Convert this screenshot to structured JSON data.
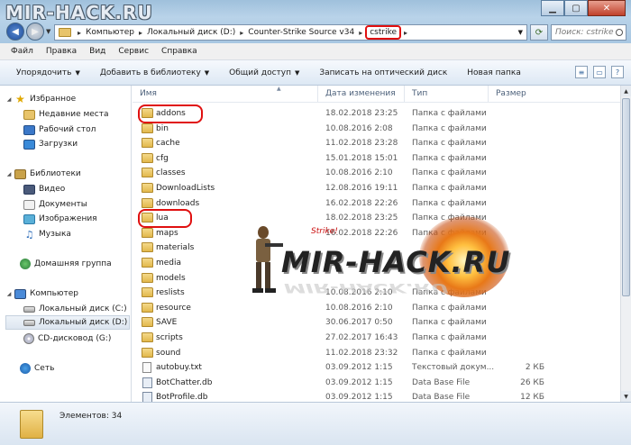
{
  "watermark_top": "MIR-HACK.RU",
  "address": {
    "crumbs": [
      "Компьютер",
      "Локальный диск (D:)",
      "Counter-Strike Source v34",
      "cstrike"
    ]
  },
  "search": {
    "placeholder": "Поиск: cstrike"
  },
  "menu": [
    "Файл",
    "Правка",
    "Вид",
    "Сервис",
    "Справка"
  ],
  "commands": [
    {
      "label": "Упорядочить",
      "dropdown": true
    },
    {
      "label": "Добавить в библиотеку",
      "dropdown": true
    },
    {
      "label": "Общий доступ",
      "dropdown": true
    },
    {
      "label": "Записать на оптический диск",
      "dropdown": false
    },
    {
      "label": "Новая папка",
      "dropdown": false
    }
  ],
  "nav": {
    "favorites": "Избранное",
    "fav_items": [
      "Недавние места",
      "Рабочий стол",
      "Загрузки"
    ],
    "libraries": "Библиотеки",
    "lib_items": [
      "Видео",
      "Документы",
      "Изображения",
      "Музыка"
    ],
    "homegroup": "Домашняя группа",
    "computer": "Компьютер",
    "drives": [
      "Локальный диск (C:)",
      "Локальный диск (D:)",
      "CD-дисковод (G:)"
    ],
    "network": "Сеть"
  },
  "columns": {
    "name": "Имя",
    "date": "Дата изменения",
    "type": "Тип",
    "size": "Размер"
  },
  "files": [
    {
      "name": "addons",
      "date": "18.02.2018 23:25",
      "type": "Папка с файлами",
      "size": "",
      "kind": "folder"
    },
    {
      "name": "bin",
      "date": "10.08.2016 2:08",
      "type": "Папка с файлами",
      "size": "",
      "kind": "folder"
    },
    {
      "name": "cache",
      "date": "11.02.2018 23:28",
      "type": "Папка с файлами",
      "size": "",
      "kind": "folder"
    },
    {
      "name": "cfg",
      "date": "15.01.2018 15:01",
      "type": "Папка с файлами",
      "size": "",
      "kind": "folder"
    },
    {
      "name": "classes",
      "date": "10.08.2016 2:10",
      "type": "Папка с файлами",
      "size": "",
      "kind": "folder"
    },
    {
      "name": "DownloadLists",
      "date": "12.08.2016 19:11",
      "type": "Папка с файлами",
      "size": "",
      "kind": "folder"
    },
    {
      "name": "downloads",
      "date": "16.02.2018 22:26",
      "type": "Папка с файлами",
      "size": "",
      "kind": "folder"
    },
    {
      "name": "lua",
      "date": "18.02.2018 23:25",
      "type": "Папка с файлами",
      "size": "",
      "kind": "folder"
    },
    {
      "name": "maps",
      "date": "16.02.2018 22:26",
      "type": "Папка с файлами",
      "size": "",
      "kind": "folder"
    },
    {
      "name": "materials",
      "date": "",
      "type": "",
      "size": "",
      "kind": "folder"
    },
    {
      "name": "media",
      "date": "",
      "type": "",
      "size": "",
      "kind": "folder"
    },
    {
      "name": "models",
      "date": "",
      "type": "",
      "size": "",
      "kind": "folder"
    },
    {
      "name": "reslists",
      "date": "10.08.2016 2:10",
      "type": "Папка с файлами",
      "size": "",
      "kind": "folder"
    },
    {
      "name": "resource",
      "date": "10.08.2016 2:10",
      "type": "Папка с файлами",
      "size": "",
      "kind": "folder"
    },
    {
      "name": "SAVE",
      "date": "30.06.2017 0:50",
      "type": "Папка с файлами",
      "size": "",
      "kind": "folder"
    },
    {
      "name": "scripts",
      "date": "27.02.2017 16:43",
      "type": "Папка с файлами",
      "size": "",
      "kind": "folder"
    },
    {
      "name": "sound",
      "date": "11.02.2018 23:32",
      "type": "Папка с файлами",
      "size": "",
      "kind": "folder"
    },
    {
      "name": "autobuy.txt",
      "date": "03.09.2012 1:15",
      "type": "Текстовый докум...",
      "size": "2 КБ",
      "kind": "file"
    },
    {
      "name": "BotChatter.db",
      "date": "03.09.2012 1:15",
      "type": "Data Base File",
      "size": "26 КБ",
      "kind": "db"
    },
    {
      "name": "BotProfile.db",
      "date": "03.09.2012 1:15",
      "type": "Data Base File",
      "size": "12 КБ",
      "kind": "db"
    }
  ],
  "watermark_center": {
    "text": "MIR-HACK.RU",
    "tag": "Strike!",
    "dates_hint": ""
  },
  "status": {
    "items": "Элементов: 34"
  },
  "colors": {
    "highlight": "#e01010",
    "folder": "#e8c46a",
    "chrome": "#b9d3e9"
  }
}
